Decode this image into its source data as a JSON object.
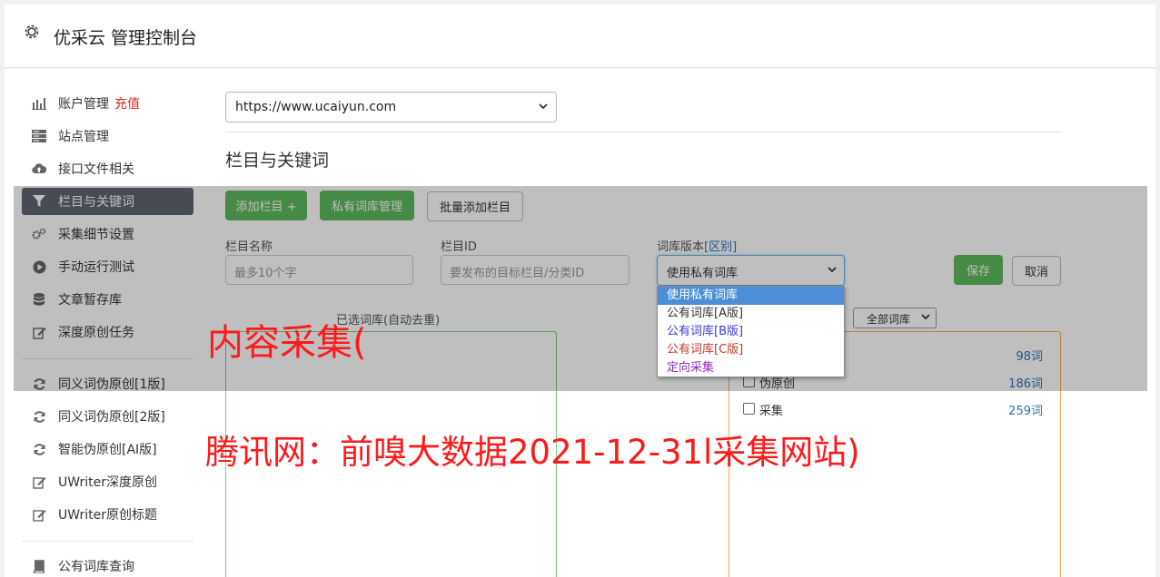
{
  "header": {
    "title": "优采云 管理控制台",
    "icon": "gear-icon"
  },
  "sidebar": {
    "items": [
      {
        "label": "账户管理",
        "badge": "充值",
        "icon": "bar-chart-icon"
      },
      {
        "label": "站点管理",
        "icon": "server-icon"
      },
      {
        "label": "接口文件相关",
        "icon": "cloud-upload-icon"
      },
      {
        "label": "栏目与关键词",
        "icon": "filter-icon",
        "active": true
      },
      {
        "label": "采集细节设置",
        "icon": "cogs-icon"
      },
      {
        "label": "手动运行测试",
        "icon": "play-circle-icon"
      },
      {
        "label": "文章暂存库",
        "icon": "database-icon"
      },
      {
        "label": "深度原创任务",
        "icon": "edit-icon"
      },
      {
        "label": "同义词伪原创[1版]",
        "icon": "refresh-icon"
      },
      {
        "label": "同义词伪原创[2版]",
        "icon": "refresh-icon"
      },
      {
        "label": "智能伪原创[AI版]",
        "icon": "refresh-icon"
      },
      {
        "label": "UWriter深度原创",
        "icon": "edit-icon"
      },
      {
        "label": "UWriter原创标题",
        "icon": "edit-icon"
      },
      {
        "label": "公有词库查询",
        "icon": "book-icon"
      }
    ]
  },
  "site_select": {
    "value": "https://www.ucaiyun.com"
  },
  "section_title": "栏目与关键词",
  "toolbar": {
    "add_column": "添加栏目 +",
    "private_lib": "私有词库管理",
    "batch_add": "批量添加栏目"
  },
  "form": {
    "column_name_label": "栏目名称",
    "column_name_placeholder": "最多10个字",
    "column_id_label": "栏目ID",
    "column_id_placeholder": "要发布的目标栏目/分类ID",
    "lib_version_label": "词库版本",
    "lib_version_link": "[区别]",
    "lib_version_value": "使用私有词库",
    "save": "保存",
    "cancel": "取消"
  },
  "version_options": [
    {
      "label": "使用私有词库",
      "color": "#ffffff",
      "selected": true
    },
    {
      "label": "公有词库[A版]",
      "color": "#333333"
    },
    {
      "label": "公有词库[B版]",
      "color": "#3a3ad6"
    },
    {
      "label": "公有词库[C版]",
      "color": "#c0392b"
    },
    {
      "label": "定向采集",
      "color": "#8e2ab8"
    }
  ],
  "selected_lib_label": "已选词库(自动去重)",
  "lib_filter": {
    "value": "全部词库"
  },
  "lib_rows": [
    {
      "name": "",
      "count": "98词"
    },
    {
      "name": "伪原创",
      "count": "186词"
    },
    {
      "name": "采集",
      "count": "259词"
    }
  ],
  "watermark": {
    "line1": "内容采集(",
    "line2": "腾讯网：前嗅大数据2021-12-31l采集网站)"
  },
  "colors": {
    "active_nav": "#5e6470",
    "green_button": "#5cb85c",
    "link_blue": "#2f6fb5",
    "watermark": "#ff1a1a"
  }
}
